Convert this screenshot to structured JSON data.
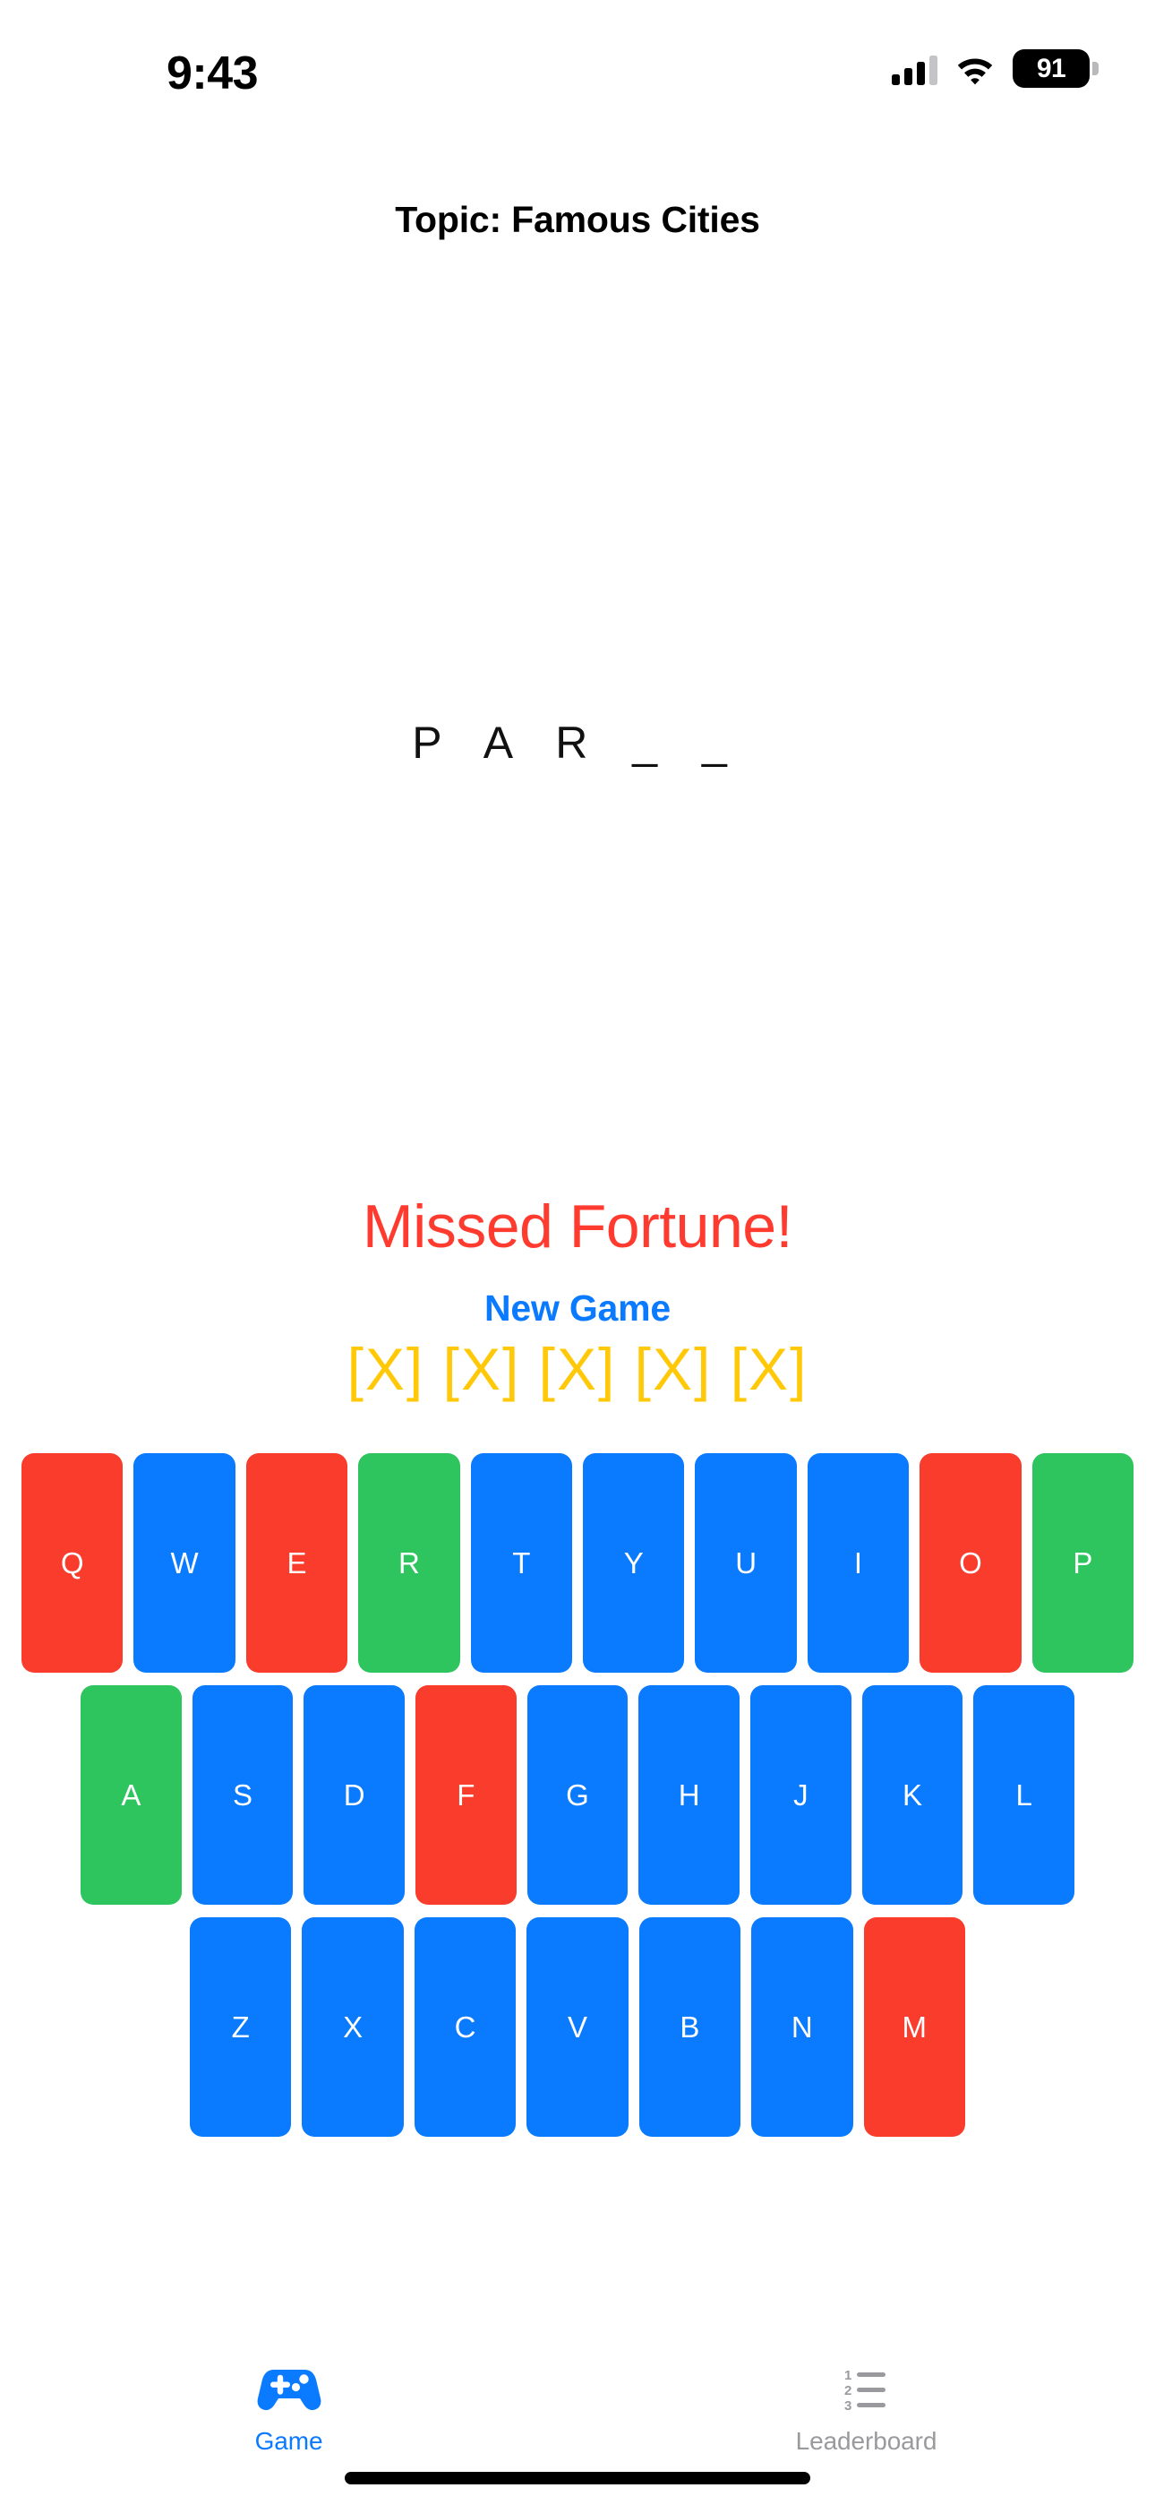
{
  "status_bar": {
    "time": "9:43",
    "signal_icon": "cellular-signal-icon",
    "wifi_icon": "wifi-icon",
    "battery_level": "91",
    "battery_icon": "battery-icon"
  },
  "header": {
    "topic_label": "Topic: Famous Cities"
  },
  "game": {
    "word_display": "P A R _ _",
    "result_message": "Missed Fortune!",
    "new_game_label": "New Game",
    "strikes_display": "[X] [X] [X] [X] [X]",
    "strike_count": 5,
    "colors": {
      "result_red": "#ff3b30",
      "accent_blue": "#0a7aff",
      "strike_gold": "#ffc90a",
      "key_blue": "#0a7aff",
      "key_red": "#fa3c2d",
      "key_green": "#34c759",
      "key_green_alt": "#2ec45e"
    }
  },
  "keyboard": {
    "rows": [
      [
        {
          "letter": "Q",
          "state": "wrong",
          "color": "#fa3c2d"
        },
        {
          "letter": "W",
          "state": "unused",
          "color": "#0a7aff"
        },
        {
          "letter": "E",
          "state": "wrong",
          "color": "#fa3c2d"
        },
        {
          "letter": "R",
          "state": "correct",
          "color": "#2ec45e"
        },
        {
          "letter": "T",
          "state": "unused",
          "color": "#0a7aff"
        },
        {
          "letter": "Y",
          "state": "unused",
          "color": "#0a7aff"
        },
        {
          "letter": "U",
          "state": "unused",
          "color": "#0a7aff"
        },
        {
          "letter": "I",
          "state": "unused",
          "color": "#0a7aff"
        },
        {
          "letter": "O",
          "state": "wrong",
          "color": "#fa3c2d"
        },
        {
          "letter": "P",
          "state": "correct",
          "color": "#2ec45e"
        }
      ],
      [
        {
          "letter": "A",
          "state": "correct",
          "color": "#2ec45e"
        },
        {
          "letter": "S",
          "state": "unused",
          "color": "#0a7aff"
        },
        {
          "letter": "D",
          "state": "unused",
          "color": "#0a7aff"
        },
        {
          "letter": "F",
          "state": "wrong",
          "color": "#fa3c2d"
        },
        {
          "letter": "G",
          "state": "unused",
          "color": "#0a7aff"
        },
        {
          "letter": "H",
          "state": "unused",
          "color": "#0a7aff"
        },
        {
          "letter": "J",
          "state": "unused",
          "color": "#0a7aff"
        },
        {
          "letter": "K",
          "state": "unused",
          "color": "#0a7aff"
        },
        {
          "letter": "L",
          "state": "unused",
          "color": "#0a7aff"
        }
      ],
      [
        {
          "letter": "Z",
          "state": "unused",
          "color": "#0a7aff"
        },
        {
          "letter": "X",
          "state": "unused",
          "color": "#0a7aff"
        },
        {
          "letter": "C",
          "state": "unused",
          "color": "#0a7aff"
        },
        {
          "letter": "V",
          "state": "unused",
          "color": "#0a7aff"
        },
        {
          "letter": "B",
          "state": "unused",
          "color": "#0a7aff"
        },
        {
          "letter": "N",
          "state": "unused",
          "color": "#0a7aff"
        },
        {
          "letter": "M",
          "state": "wrong",
          "color": "#fa3c2d"
        }
      ]
    ]
  },
  "tab_bar": {
    "items": [
      {
        "label": "Game",
        "icon": "gamepad-icon",
        "active": true
      },
      {
        "label": "Leaderboard",
        "icon": "numbered-list-icon",
        "active": false
      }
    ]
  }
}
